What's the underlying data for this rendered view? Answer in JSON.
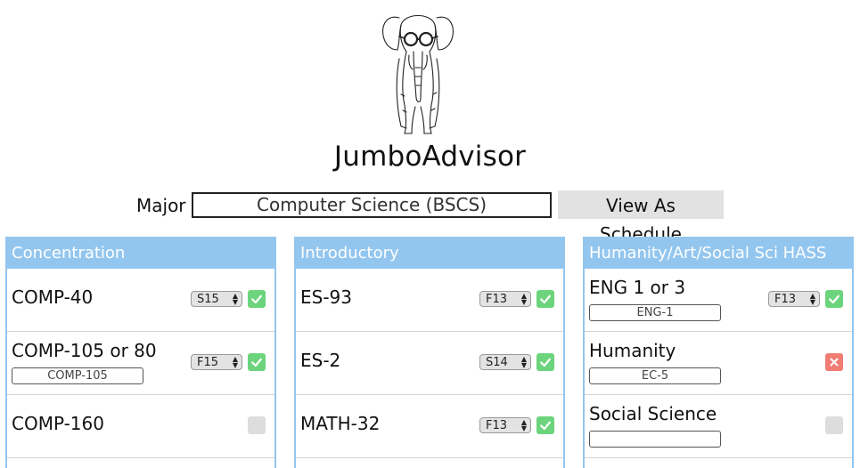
{
  "app": {
    "title": "JumboAdvisor"
  },
  "major": {
    "label": "Major",
    "value": "Computer Science (BSCS)",
    "view_button": "View As Schedule"
  },
  "colors": {
    "accent": "#93c6ef",
    "done": "#6cd47c",
    "missing": "#f07c74",
    "empty": "#dddddd"
  },
  "panels": [
    {
      "title": "Concentration",
      "rows": [
        {
          "name": "COMP-40",
          "term": "S15",
          "status": "done"
        },
        {
          "name": "COMP-105 or 80",
          "input": "COMP-105",
          "term": "F15",
          "status": "done"
        },
        {
          "name": "COMP-160",
          "status": "empty"
        }
      ]
    },
    {
      "title": "Introductory",
      "rows": [
        {
          "name": "ES-93",
          "term": "F13",
          "status": "done"
        },
        {
          "name": "ES-2",
          "term": "S14",
          "status": "done"
        },
        {
          "name": "MATH-32",
          "term": "F13",
          "status": "done"
        }
      ]
    },
    {
      "title": "Humanity/Art/Social Sci HASS",
      "rows": [
        {
          "name": "ENG 1 or 3",
          "input": "ENG-1",
          "term": "F13",
          "status": "done"
        },
        {
          "name": "Humanity",
          "input": "EC-5",
          "status": "missing"
        },
        {
          "name": "Social Science",
          "input": "",
          "status": "empty"
        }
      ]
    }
  ]
}
